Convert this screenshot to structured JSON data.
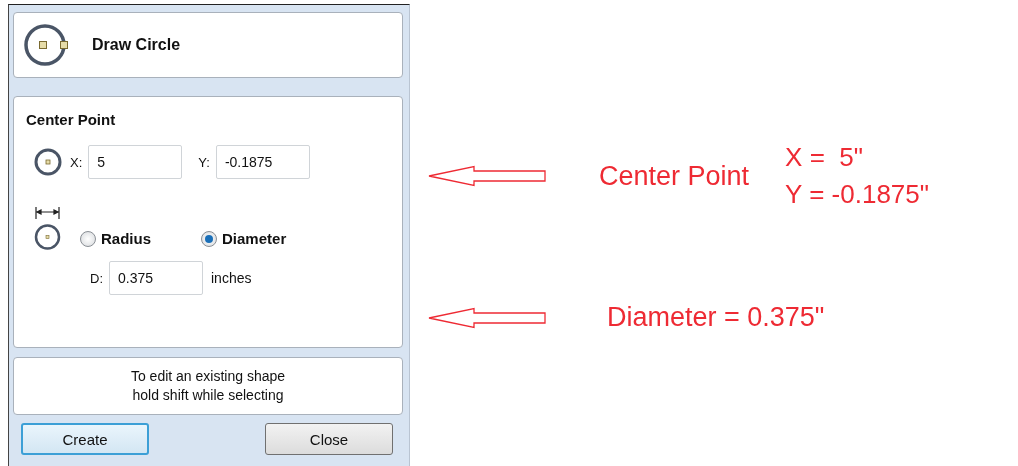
{
  "header": {
    "title": "Draw Circle"
  },
  "center_point": {
    "heading": "Center Point",
    "x_label": "X:",
    "x_value": "5",
    "y_label": "Y:",
    "y_value": "-0.1875"
  },
  "size_mode": [
    {
      "label": "Radius",
      "selected": false
    },
    {
      "label": "Diameter",
      "selected": true
    }
  ],
  "size": {
    "label": "D:",
    "value": "0.375",
    "unit": "inches"
  },
  "hint": "To edit an existing shape\nhold shift while selecting",
  "buttons": [
    {
      "label": "Create",
      "focused": true
    },
    {
      "label": "Close",
      "focused": false
    }
  ],
  "annotations": [
    {
      "label": "Center Point",
      "values": [
        "X =  5\"",
        "Y = -0.1875\""
      ]
    },
    {
      "label": "Diameter = 0.375\""
    }
  ]
}
